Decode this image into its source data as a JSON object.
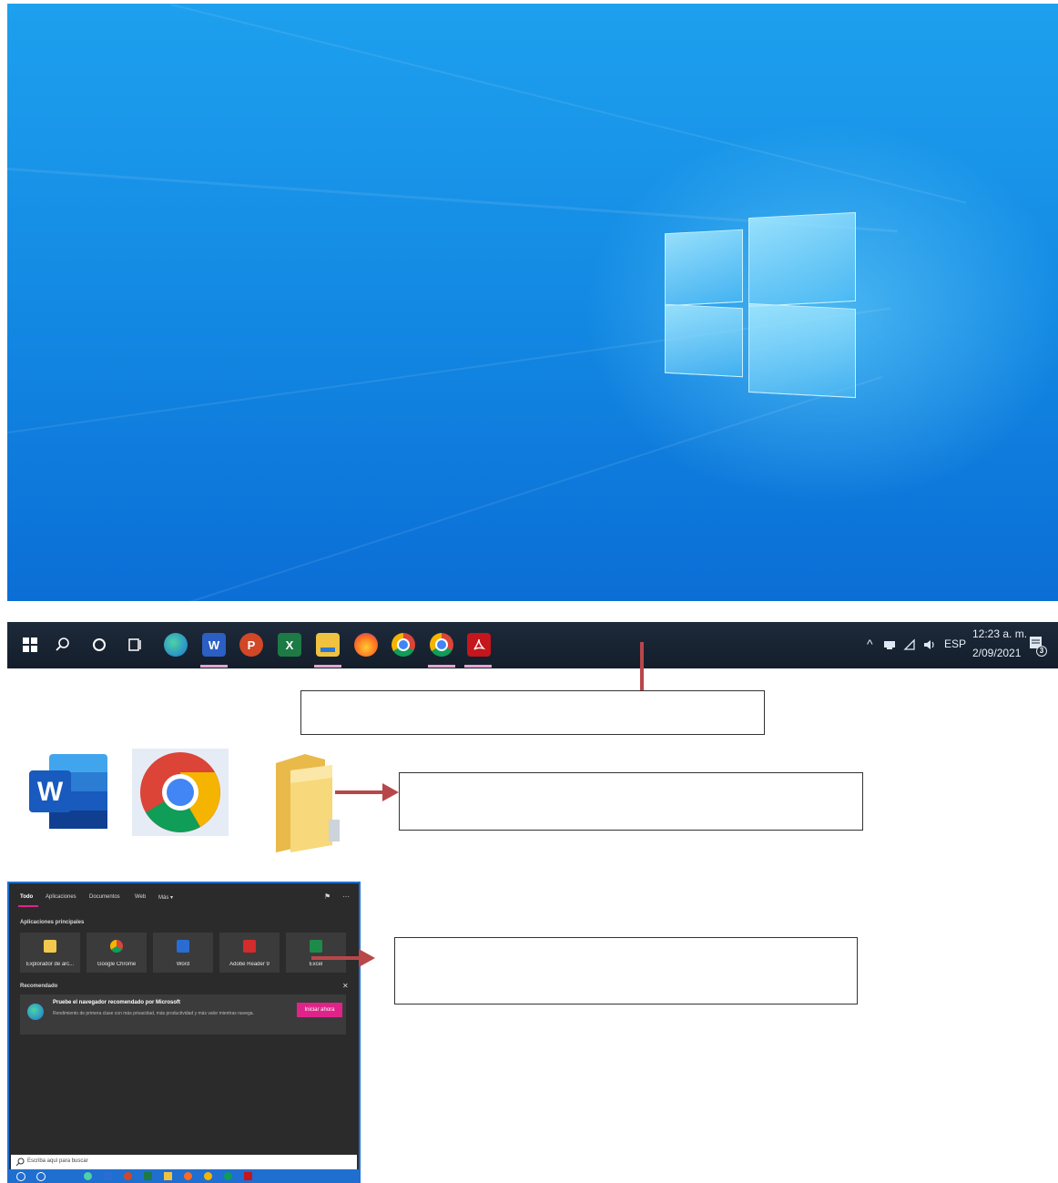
{
  "taskbar": {
    "items": [
      {
        "name": "start"
      },
      {
        "name": "search"
      },
      {
        "name": "cortana"
      },
      {
        "name": "task-view"
      },
      {
        "name": "edge"
      },
      {
        "name": "word",
        "label": "W"
      },
      {
        "name": "powerpoint",
        "label": "P"
      },
      {
        "name": "excel",
        "label": "X"
      },
      {
        "name": "file-explorer"
      },
      {
        "name": "firefox"
      },
      {
        "name": "chrome"
      },
      {
        "name": "chrome-alt"
      },
      {
        "name": "adobe-reader"
      }
    ],
    "tray": {
      "language": "ESP",
      "time": "12:23 a. m.",
      "date": "2/09/2021",
      "notification_count": "3"
    }
  },
  "icons": {
    "word_letter": "W"
  },
  "search_panel": {
    "tabs": [
      "Todo",
      "Aplicaciones",
      "Documentos",
      "Web",
      "Más ▾"
    ],
    "top_apps_heading": "Aplicaciones principales",
    "top_apps": [
      {
        "label": "Explorador de arc...",
        "color": "#f2c94c"
      },
      {
        "label": "Google Chrome",
        "color": "#e8a33d"
      },
      {
        "label": "Word",
        "color": "#2b6cd4"
      },
      {
        "label": "Adobe Reader 9",
        "color": "#d42b2b"
      },
      {
        "label": "Excel",
        "color": "#1e8a4a"
      }
    ],
    "recommended_heading": "Recomendado",
    "recommended": {
      "title": "Pruebe el navegador recomendado por Microsoft",
      "body": "Rendimiento de primera clase con más privacidad, más productividad y más valor mientras navega.",
      "button": "Iniciar ahora"
    },
    "search_placeholder": "Escriba aquí para buscar"
  },
  "colors": {
    "taskbar_bg": "#1a2533",
    "callout_line": "#b8474a",
    "button_accent": "#e0238a"
  }
}
